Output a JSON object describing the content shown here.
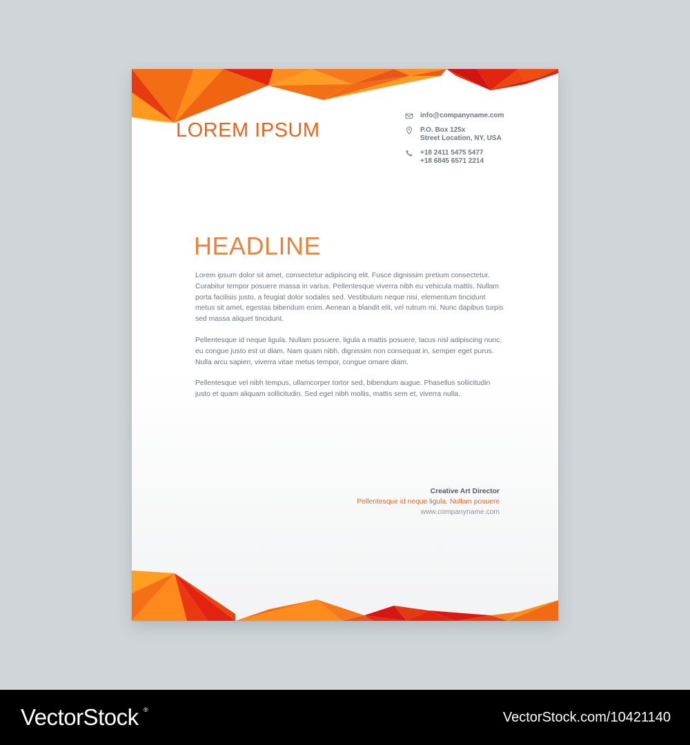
{
  "letterhead": {
    "brand": "LOREM IPSUM",
    "contact": {
      "email": "info@companyname.com",
      "address_line1": "P.O. Box 125x",
      "address_line2": "Street Location, NY, USA",
      "phone_line1": "+18 2411 5475 5477",
      "phone_line2": "+18 6845 6571 2214",
      "icons": [
        "envelope-icon",
        "location-pin-icon",
        "phone-icon"
      ]
    },
    "headline": "HEADLINE",
    "paragraphs": [
      "Lorem ipsum dolor sit amet, consectetur adipiscing elit. Fusce dignissim pretium consectetur. Curabitur tempor posuere massa in varius. Pellentesque viverra nibh eu vehicula mattis. Nullam porta facilisis justo, a feugiat dolor sodales sed. Vestibulum neque nisi, elementum tincidunt metus sit amet, egestas bibendum enim. Aenean a blandit elit, vel rutrum mi. Nunc dapibus turpis sed massa aliquet tincidunt.",
      "Pellentesque id neque ligula. Nullam posuere, ligula a mattis posuere, lacus nisl adipiscing nunc, eu congue justo est ut diam. Nam quam nibh, dignissim non consequat in, semper eget purus. Nulla arcu sapien, viverra vitae metus tempor, congue ornare diam.",
      "Pellentesque vel nibh tempus, ullamcorper tortor sed, bibendum augue. Phasellus sollicitudin justo et quam aliquam sollicitudin. Sed eget nibh mollis, mattis sem et, viverra nulla."
    ],
    "signature": {
      "title": "Creative Art Director",
      "line": "Pellentesque id neque ligula. Nullam posuere",
      "website": "www.companyname.com"
    }
  },
  "watermark": {
    "logo_text": "VectorStock",
    "image_id": "VectorStock.com/10421140"
  },
  "colors": {
    "background": "#cfd5d9",
    "paper": "#ffffff",
    "accent_orange": "#e8641b",
    "accent_red": "#e41f13",
    "accent_yellow": "#ff9f1a",
    "body_text": "#6b7684"
  }
}
